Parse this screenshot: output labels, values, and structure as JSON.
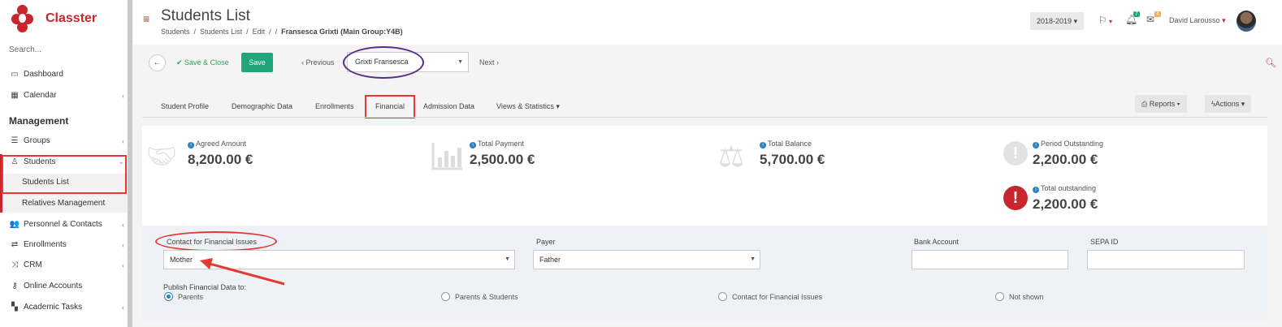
{
  "brand": {
    "name": "Classter",
    "color": "#c9252c"
  },
  "sidebar": {
    "search_placeholder": "Search...",
    "section": "Management",
    "items": [
      {
        "label": "Dashboard",
        "icon": "laptop-icon"
      },
      {
        "label": "Calendar",
        "icon": "calendar-icon"
      },
      {
        "label": "Groups",
        "icon": "list-icon"
      },
      {
        "label": "Students",
        "icon": "user-icon"
      },
      {
        "label": "Personnel & Contacts",
        "icon": "users-icon"
      },
      {
        "label": "Enrollments",
        "icon": "exchange-icon"
      },
      {
        "label": "CRM",
        "icon": "random-icon"
      },
      {
        "label": "Online Accounts",
        "icon": "key-icon"
      },
      {
        "label": "Academic Tasks",
        "icon": "grid-icon"
      }
    ],
    "students_sub": [
      "Students List",
      "Relatives Management"
    ]
  },
  "header": {
    "title": "Students List",
    "breadcrumb": [
      "Students",
      "/",
      "Students List",
      "/",
      "Edit",
      "/",
      "/"
    ],
    "breadcrumb_current": "Fransesca Grixti (Main Group:Y4B)",
    "year": "2018-2019",
    "notifications_count": "7",
    "messages_count": "4",
    "user": "David Larousso"
  },
  "toolbar": {
    "save_close": "Save & Close",
    "save": "Save",
    "previous": "Previous",
    "student": "Grixti Fransesca",
    "next": "Next"
  },
  "tabs": [
    "Student Profile",
    "Demographic Data",
    "Enrollments",
    "Financial",
    "Admission Data",
    "Views & Statistics"
  ],
  "active_tab": "Financial",
  "buttons": {
    "reports": "Reports",
    "actions": "Actions"
  },
  "summary": [
    {
      "label": "Agreed Amount",
      "value": "8,200.00 €"
    },
    {
      "label": "Total Payment",
      "value": "2,500.00 €"
    },
    {
      "label": "Total Balance",
      "value": "5,700.00 €"
    },
    {
      "label": "Period Outstanding",
      "value": "2,200.00 €"
    },
    {
      "label": "Total outstanding",
      "value": "2,200.00 €"
    }
  ],
  "form": {
    "contact_label": "Contact for Financial Issues",
    "contact_value": "Mother",
    "payer_label": "Payer",
    "payer_value": "Father",
    "bank_label": "Bank Account",
    "sepa_label": "SEPA ID",
    "publish_label": "Publish Financial Data to:",
    "publish_options": [
      "Parents",
      "Parents & Students",
      "Contact for Financial Issues",
      "Not shown"
    ],
    "publish_selected": "Parents"
  },
  "colors": {
    "accent": "#c9252c",
    "save": "#1fa67a",
    "highlight": "#e53935",
    "annotation_purple": "#5b2b8c",
    "info": "#2d7fc0"
  }
}
